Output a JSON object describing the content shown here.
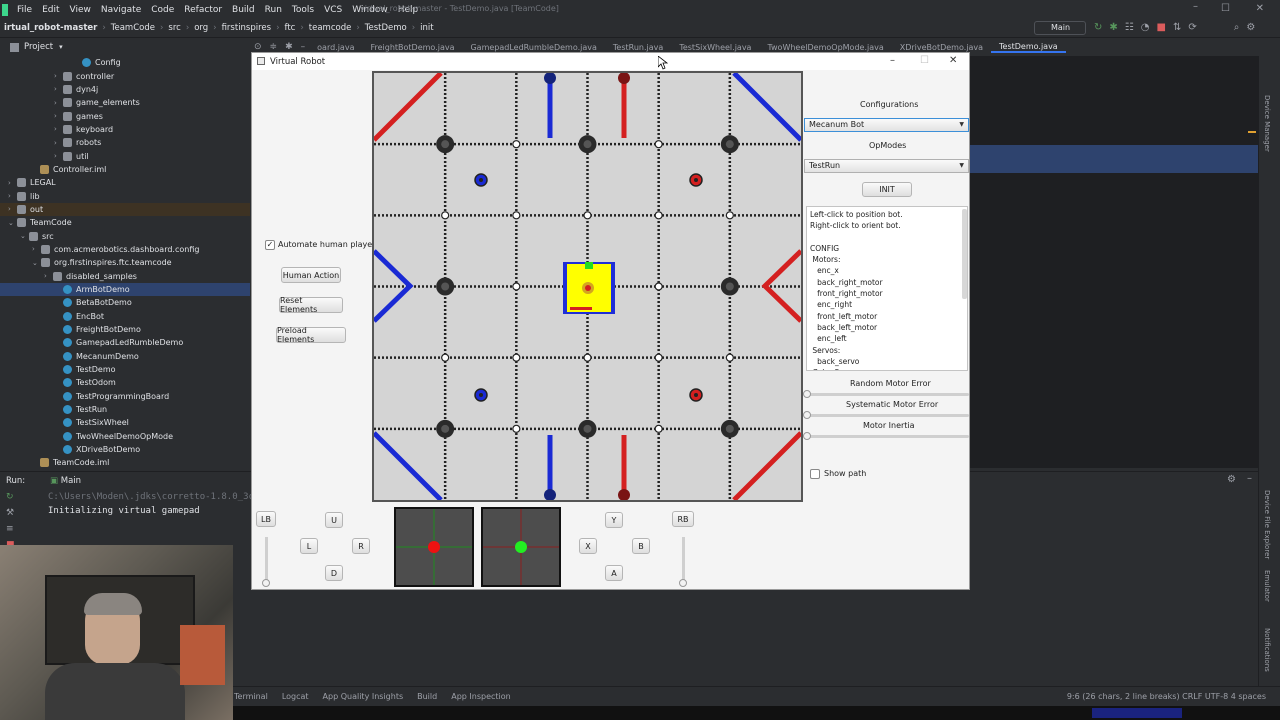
{
  "ide": {
    "menu": [
      "File",
      "Edit",
      "View",
      "Navigate",
      "Code",
      "Refactor",
      "Build",
      "Run",
      "Tools",
      "VCS",
      "Window",
      "Help"
    ],
    "window_title": "virtual_robot-master - TestDemo.java [TeamCode]",
    "breadcrumb": [
      "irtual_robot-master",
      "TeamCode",
      "src",
      "org",
      "firstinspires",
      "ftc",
      "teamcode",
      "TestDemo",
      "init"
    ],
    "run_config": "Main",
    "project_label": "Project",
    "tree": [
      {
        "label": "Config",
        "indent": 85,
        "kind": "cls",
        "caret": ""
      },
      {
        "label": "controller",
        "indent": 66,
        "kind": "folder",
        "caret": "›"
      },
      {
        "label": "dyn4j",
        "indent": 66,
        "kind": "folder",
        "caret": "›"
      },
      {
        "label": "game_elements",
        "indent": 66,
        "kind": "folder",
        "caret": "›"
      },
      {
        "label": "games",
        "indent": 66,
        "kind": "folder",
        "caret": "›"
      },
      {
        "label": "keyboard",
        "indent": 66,
        "kind": "folder",
        "caret": "›"
      },
      {
        "label": "robots",
        "indent": 66,
        "kind": "folder",
        "caret": "›"
      },
      {
        "label": "util",
        "indent": 66,
        "kind": "folder",
        "caret": "›"
      },
      {
        "label": "Controller.iml",
        "indent": 43,
        "kind": "file",
        "caret": ""
      },
      {
        "label": "LEGAL",
        "indent": 20,
        "kind": "folder",
        "caret": "›"
      },
      {
        "label": "lib",
        "indent": 20,
        "kind": "folder",
        "caret": "›"
      },
      {
        "label": "out",
        "indent": 20,
        "kind": "folder",
        "caret": "›",
        "hl": true
      },
      {
        "label": "TeamCode",
        "indent": 20,
        "kind": "folder",
        "caret": "⌄"
      },
      {
        "label": "src",
        "indent": 32,
        "kind": "folder",
        "caret": "⌄"
      },
      {
        "label": "com.acmerobotics.dashboard.config",
        "indent": 44,
        "kind": "folder",
        "caret": "›"
      },
      {
        "label": "org.firstinspires.ftc.teamcode",
        "indent": 44,
        "kind": "folder",
        "caret": "⌄"
      },
      {
        "label": "disabled_samples",
        "indent": 56,
        "kind": "folder",
        "caret": "›"
      },
      {
        "label": "ArmBotDemo",
        "indent": 66,
        "kind": "cls",
        "caret": "",
        "sel": true
      },
      {
        "label": "BetaBotDemo",
        "indent": 66,
        "kind": "cls",
        "caret": ""
      },
      {
        "label": "EncBot",
        "indent": 66,
        "kind": "cls",
        "caret": ""
      },
      {
        "label": "FreightBotDemo",
        "indent": 66,
        "kind": "cls",
        "caret": ""
      },
      {
        "label": "GamepadLedRumbleDemo",
        "indent": 66,
        "kind": "cls",
        "caret": ""
      },
      {
        "label": "MecanumDemo",
        "indent": 66,
        "kind": "cls",
        "caret": ""
      },
      {
        "label": "TestDemo",
        "indent": 66,
        "kind": "cls",
        "caret": ""
      },
      {
        "label": "TestOdom",
        "indent": 66,
        "kind": "cls",
        "caret": ""
      },
      {
        "label": "TestProgrammingBoard",
        "indent": 66,
        "kind": "cls",
        "caret": ""
      },
      {
        "label": "TestRun",
        "indent": 66,
        "kind": "cls",
        "caret": ""
      },
      {
        "label": "TestSixWheel",
        "indent": 66,
        "kind": "cls",
        "caret": ""
      },
      {
        "label": "TwoWheelDemoOpMode",
        "indent": 66,
        "kind": "cls",
        "caret": ""
      },
      {
        "label": "XDriveBotDemo",
        "indent": 66,
        "kind": "cls",
        "caret": ""
      },
      {
        "label": "TeamCode.iml",
        "indent": 43,
        "kind": "file",
        "caret": ""
      }
    ],
    "tabs": [
      "oard.java",
      "FreightBotDemo.java",
      "GamepadLedRumbleDemo.java",
      "TestRun.java",
      "TestSixWheel.java",
      "TwoWheelDemoOpMode.java",
      "XDriveBotDemo.java",
      "TestDemo.java"
    ],
    "active_tab": "TestDemo.java",
    "warnings": "▲1",
    "run": {
      "label": "Run:",
      "tab": "Main",
      "lines": [
        "C:\\Users\\Moden\\.jdks\\corretto-1.8.0_3c",
        "Initializing virtual gamepad"
      ]
    },
    "status_items": [
      "Terminal",
      "Logcat",
      "App Quality Insights",
      "Build",
      "App Inspection"
    ],
    "status_right": "9:6 (26 chars, 2 line breaks)   CRLF   UTF-8   4 spaces",
    "side_labels": [
      "Device Manager",
      "Device File Explorer",
      "Emulator",
      "Notifications"
    ]
  },
  "vr": {
    "title": "Virtual Robot",
    "automate_label": "Automate human player",
    "automate_checked": true,
    "buttons": {
      "human": "Human Action",
      "reset": "Reset Elements",
      "preload": "Preload Elements",
      "init": "INIT"
    },
    "configurations_label": "Configurations",
    "configuration": "Mecanum Bot",
    "opmodes_label": "OpModes",
    "opmode": "TestRun",
    "info_text": "Left-click to position bot.\nRight-click to orient bot.\n\nCONFIG\n Motors:\n   enc_x\n   back_right_motor\n   front_right_motor\n   enc_right\n   front_left_motor\n   back_left_motor\n   enc_left\n Servos:\n   back_servo\n Color Sensors:",
    "random_error": "Random Motor Error",
    "systematic_error": "Systematic Motor Error",
    "inertia": "Motor Inertia",
    "show_path": "Show path",
    "show_path_checked": false,
    "gamepad": {
      "lb": "LB",
      "rb": "RB",
      "u": "U",
      "l": "L",
      "r": "R",
      "d": "D",
      "y": "Y",
      "x": "X",
      "b": "B",
      "a": "A"
    },
    "colors": {
      "red": "#d42020",
      "blue": "#1a2ad4",
      "robot": "#ffff00",
      "stick_left": "#ee1111",
      "stick_right": "#22ee22"
    }
  }
}
